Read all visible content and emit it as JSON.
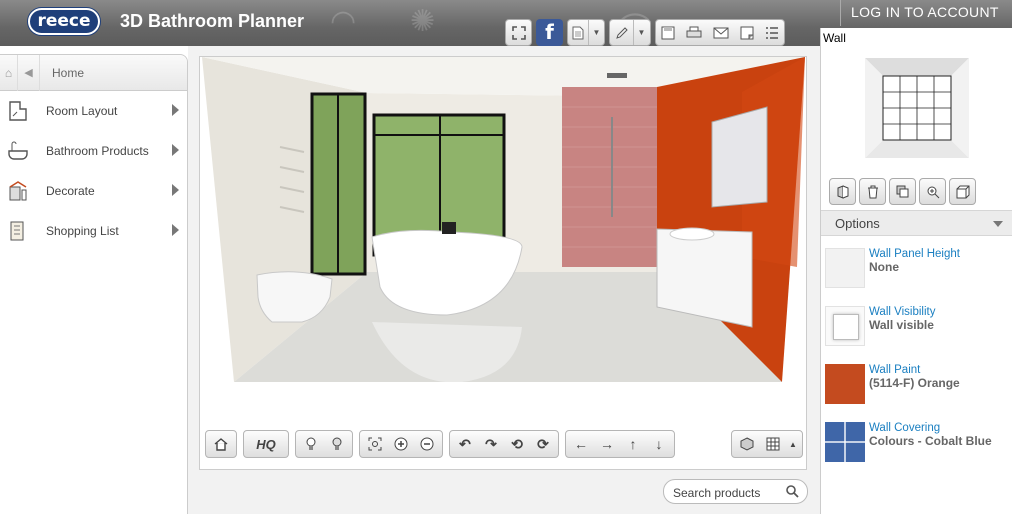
{
  "header": {
    "logo_text": "reece",
    "app_title": "3D Bathroom Planner",
    "login_label": "LOG IN TO ACCOUNT",
    "facebook_glyph": "f",
    "toolbar_icons": [
      "fullscreen-icon",
      "facebook-icon",
      "document-icon",
      "pencil-icon",
      "save-icon",
      "print-icon",
      "email-icon",
      "window-icon",
      "list-icon"
    ]
  },
  "left_panel": {
    "home_label": "Home",
    "items": [
      {
        "label": "Room Layout",
        "icon": "room-layout-icon"
      },
      {
        "label": "Bathroom Products",
        "icon": "bathroom-products-icon"
      },
      {
        "label": "Decorate",
        "icon": "decorate-icon"
      },
      {
        "label": "Shopping List",
        "icon": "shopping-list-icon"
      }
    ]
  },
  "center": {
    "hq_label": "HQ",
    "search_placeholder": "Search products"
  },
  "right_panel": {
    "selection_label": "Wall",
    "options_label": "Options",
    "options": [
      {
        "name": "Wall Panel Height",
        "value": "None",
        "swatch": "#f2f2f2"
      },
      {
        "name": "Wall Visibility",
        "value": "Wall visible",
        "swatch": "#ffffff"
      },
      {
        "name": "Wall Paint",
        "value": "(5114-F) Orange",
        "swatch": "#c44b1f"
      },
      {
        "name": "Wall Covering",
        "value": "Colours - Cobalt Blue",
        "swatch": "#3f66a8"
      }
    ]
  },
  "colors": {
    "accent_link": "#1a7fc1",
    "header_bg": "#6a6a6a",
    "brand_blue": "#1f3f7a",
    "wall_orange": "#c44b1f",
    "cobalt_blue": "#3f66a8"
  }
}
